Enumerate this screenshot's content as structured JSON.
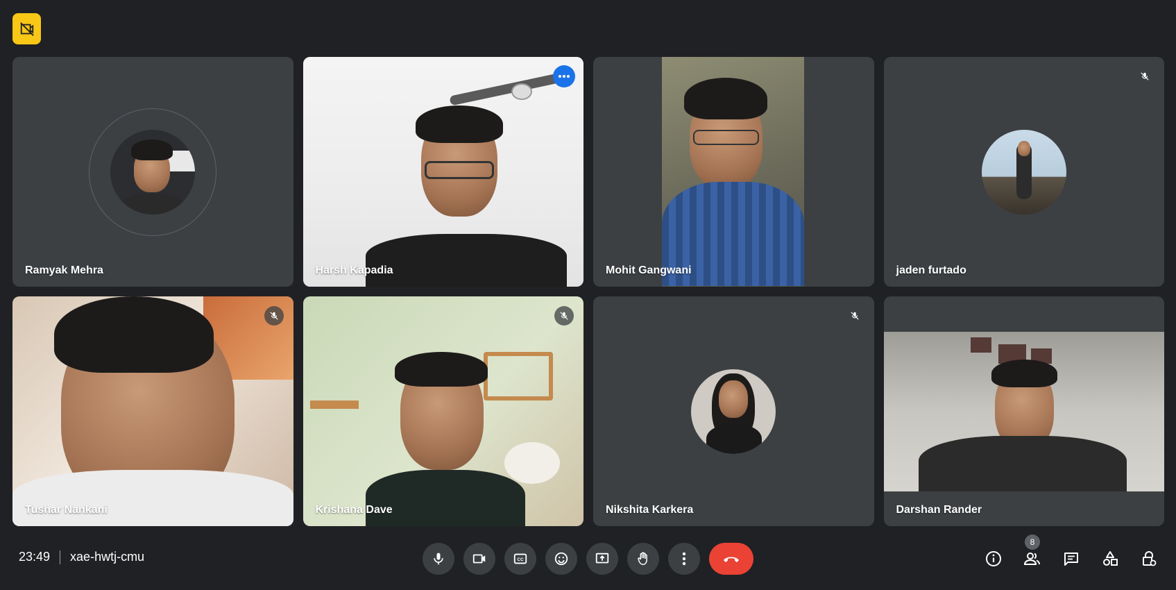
{
  "meeting": {
    "time": "23:49",
    "code": "xae-hwtj-cmu"
  },
  "participants": [
    {
      "name": "Ramyak Mehra",
      "video": false,
      "muted": false,
      "active": false
    },
    {
      "name": "Harsh Kapadia",
      "video": true,
      "muted": false,
      "active": true
    },
    {
      "name": "Mohit Gangwani",
      "video": true,
      "muted": false,
      "active": false
    },
    {
      "name": "jaden furtado",
      "video": false,
      "muted": true,
      "active": false
    },
    {
      "name": "Tushar Nankani",
      "video": true,
      "muted": true,
      "active": false
    },
    {
      "name": "Krishana Dave",
      "video": true,
      "muted": true,
      "active": false
    },
    {
      "name": "Nikshita Karkera",
      "video": false,
      "muted": true,
      "active": false
    },
    {
      "name": "Darshan Rander",
      "video": true,
      "muted": false,
      "active": false
    }
  ],
  "people_count": "8",
  "colors": {
    "background": "#202124",
    "tile": "#3c4043",
    "accent_blue": "#8ab4f8",
    "end_call_red": "#ea4335",
    "badge_yellow": "#f9c715"
  },
  "controls": [
    "mic-icon",
    "camera-icon",
    "captions-icon",
    "emoji-icon",
    "present-icon",
    "raise-hand-icon",
    "more-options-icon",
    "end-call-icon"
  ],
  "side_controls": [
    "info-icon",
    "people-icon",
    "chat-icon",
    "activities-icon",
    "host-controls-icon"
  ]
}
